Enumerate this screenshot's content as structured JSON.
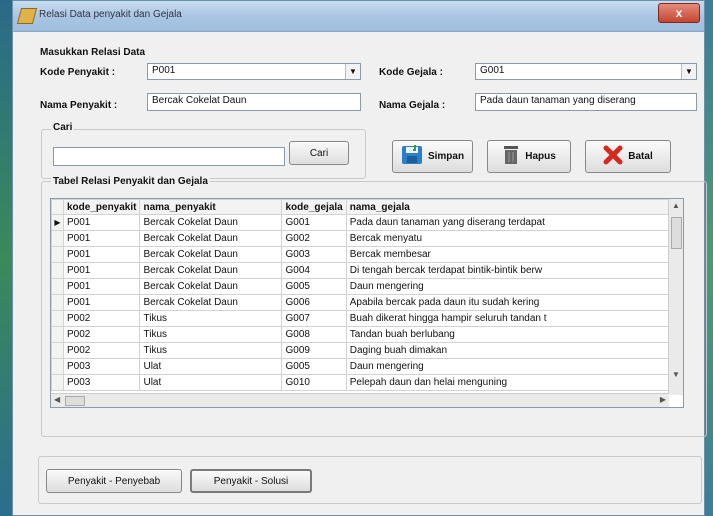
{
  "window": {
    "title": "Relasi Data penyakit dan Gejala",
    "close": "x"
  },
  "form": {
    "group_label": "Masukkan Relasi Data",
    "kode_penyakit_label": "Kode Penyakit :",
    "kode_penyakit_value": "P001",
    "nama_penyakit_label": "Nama Penyakit :",
    "nama_penyakit_value": "Bercak Cokelat Daun",
    "kode_gejala_label": "Kode Gejala :",
    "kode_gejala_value": "G001",
    "nama_gejala_label": "Nama Gejala :",
    "nama_gejala_value": "Pada daun tanaman yang diserang"
  },
  "search": {
    "group_label": "Cari",
    "value": "",
    "button": "Cari"
  },
  "actions": {
    "save": "Simpan",
    "delete": "Hapus",
    "cancel": "Batal"
  },
  "table": {
    "group_label": "Tabel Relasi Penyakit dan Gejala",
    "columns": [
      "kode_penyakit",
      "nama_penyakit",
      "kode_gejala",
      "nama_gejala"
    ],
    "rows": [
      [
        "P001",
        "Bercak Cokelat Daun",
        "G001",
        "Pada daun tanaman yang diserang terdapat"
      ],
      [
        "P001",
        "Bercak Cokelat Daun",
        "G002",
        "Bercak menyatu"
      ],
      [
        "P001",
        "Bercak Cokelat Daun",
        "G003",
        "Bercak membesar"
      ],
      [
        "P001",
        "Bercak Cokelat Daun",
        "G004",
        "Di tengah bercak terdapat bintik-bintik berw"
      ],
      [
        "P001",
        "Bercak Cokelat Daun",
        "G005",
        "Daun mengering"
      ],
      [
        "P001",
        "Bercak Cokelat Daun",
        "G006",
        "Apabila bercak pada daun itu sudah kering"
      ],
      [
        "P002",
        "Tikus",
        "G007",
        "Buah dikerat hingga hampir seluruh tandan t"
      ],
      [
        "P002",
        "Tikus",
        "G008",
        "Tandan buah berlubang"
      ],
      [
        "P002",
        "Tikus",
        "G009",
        "Daging buah dimakan"
      ],
      [
        "P003",
        "Ulat",
        "G005",
        "Daun mengering"
      ],
      [
        "P003",
        "Ulat",
        "G010",
        "Pelepah daun dan helai menguning"
      ]
    ]
  },
  "footer": {
    "btn1": "Penyakit - Penyebab",
    "btn2": "Penyakit - Solusi"
  }
}
